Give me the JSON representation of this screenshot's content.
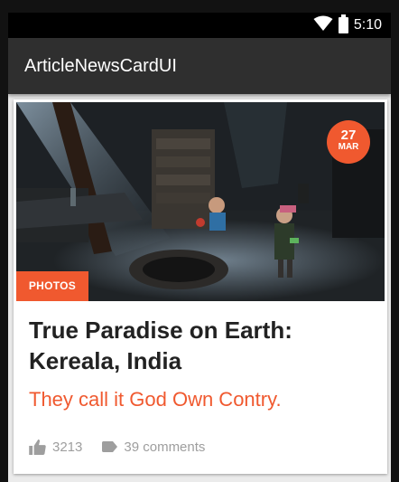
{
  "status_bar": {
    "time": "5:10",
    "icons": [
      "wifi-icon",
      "battery-icon"
    ]
  },
  "app_bar": {
    "title": "ArticleNewsCardUI"
  },
  "card": {
    "image": {
      "description_icon": "photo-of-children-in-dark-room"
    },
    "date": {
      "day": "27",
      "month": "MAR"
    },
    "category": "PHOTOS",
    "headline": "True Paradise on Earth: Kereala, India",
    "subtitle": "They call it God Own Contry.",
    "likes": {
      "count": "3213",
      "icon": "thumbs-up-icon"
    },
    "comments": {
      "label": "39 comments",
      "icon": "label-tag-icon"
    }
  },
  "colors": {
    "accent": "#f0592f",
    "app_bar": "#2f2f2f",
    "status_bar": "#000000",
    "background": "#ebebeb",
    "headline": "#222222",
    "meta_text": "#9e9e9e"
  }
}
